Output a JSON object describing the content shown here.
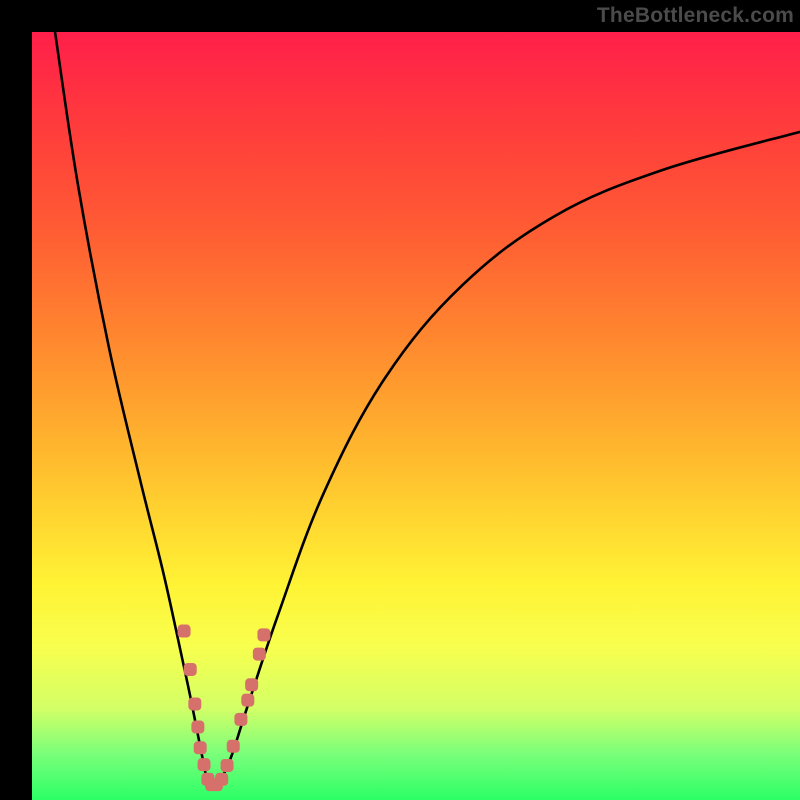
{
  "watermark": "TheBottleneck.com",
  "chart_data": {
    "type": "line",
    "title": "",
    "xlabel": "",
    "ylabel": "",
    "xlim": [
      0,
      100
    ],
    "ylim": [
      0,
      100
    ],
    "grid": false,
    "legend": false,
    "series": [
      {
        "name": "curve",
        "color": "#000000",
        "x": [
          3,
          6,
          10,
          14,
          17,
          19,
          20.5,
          21.5,
          22.3,
          23,
          24,
          25.7,
          28,
          32,
          38,
          46,
          56,
          68,
          82,
          100
        ],
        "values": [
          100,
          80,
          59,
          42,
          30,
          21,
          14,
          9,
          5,
          2,
          2,
          5,
          12,
          24,
          40,
          55,
          67,
          76,
          82,
          87
        ]
      }
    ],
    "markers": {
      "color": "#d6706b",
      "size": 13,
      "shape": "rounded-rect",
      "points": [
        {
          "x": 19.8,
          "y": 22.0
        },
        {
          "x": 20.6,
          "y": 17.0
        },
        {
          "x": 21.2,
          "y": 12.5
        },
        {
          "x": 21.6,
          "y": 9.5
        },
        {
          "x": 21.9,
          "y": 6.8
        },
        {
          "x": 22.4,
          "y": 4.6
        },
        {
          "x": 22.9,
          "y": 2.7
        },
        {
          "x": 23.4,
          "y": 2.0
        },
        {
          "x": 24.0,
          "y": 2.0
        },
        {
          "x": 24.7,
          "y": 2.7
        },
        {
          "x": 25.4,
          "y": 4.5
        },
        {
          "x": 26.2,
          "y": 7.0
        },
        {
          "x": 27.2,
          "y": 10.5
        },
        {
          "x": 28.1,
          "y": 13
        },
        {
          "x": 28.6,
          "y": 15
        },
        {
          "x": 29.6,
          "y": 19.0
        },
        {
          "x": 30.2,
          "y": 21.5
        }
      ]
    },
    "background_gradient": {
      "top_color": "#ff1f4a",
      "bottom_color": "#2bff66"
    }
  }
}
